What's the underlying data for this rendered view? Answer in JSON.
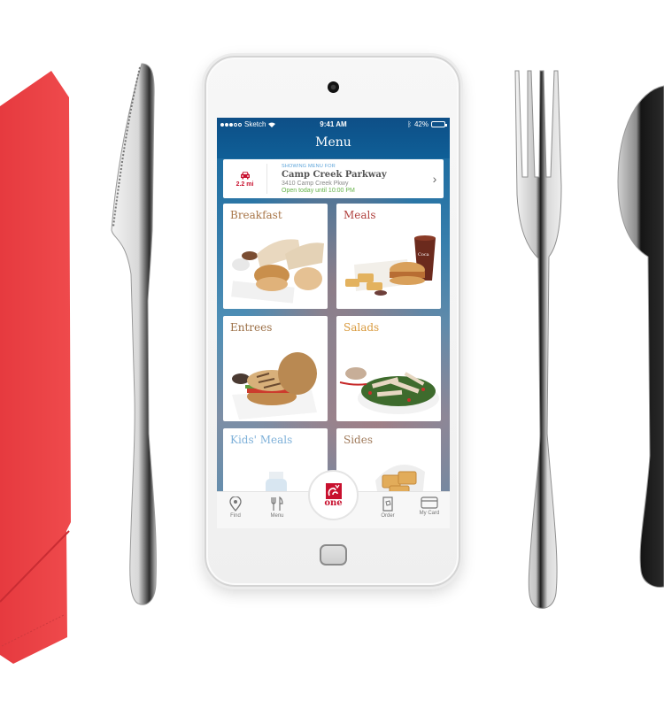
{
  "status_bar": {
    "carrier": "Sketch",
    "signal_bars_filled": 3,
    "signal_bars_total": 5,
    "time": "9:41 AM",
    "battery_percent": "42%",
    "battery_level": 0.42
  },
  "header": {
    "title": "Menu"
  },
  "location": {
    "distance": "2.2 mi",
    "label": "SHOWING MENU FOR",
    "name": "Camp Creek Parkway",
    "address": "3410 Camp Creek Pkwy",
    "hours": "Open today until 10:00 PM",
    "icon": "car-icon",
    "chevron": "›"
  },
  "categories": [
    {
      "label": "Breakfast",
      "color": "#a87648"
    },
    {
      "label": "Meals",
      "color": "#b0413e"
    },
    {
      "label": "Entrees",
      "color": "#9c7047"
    },
    {
      "label": "Salads",
      "color": "#d99a3e"
    },
    {
      "label": "Kids' Meals",
      "color": "#7fb1d9"
    },
    {
      "label": "Sides",
      "color": "#a07b5c"
    }
  ],
  "tabbar": {
    "items": [
      {
        "label": "Find",
        "icon": "location-pin-icon"
      },
      {
        "label": "Menu",
        "icon": "fork-knife-icon"
      },
      {
        "label": "Order",
        "icon": "bag-icon"
      },
      {
        "label": "My Card",
        "icon": "credit-card-icon"
      }
    ],
    "center": {
      "label": "one",
      "icon": "chick-fil-a-logo-icon"
    }
  },
  "colors": {
    "brand_red": "#c8102e",
    "header_blue": "#0f5a91",
    "open_green": "#66b34a"
  }
}
